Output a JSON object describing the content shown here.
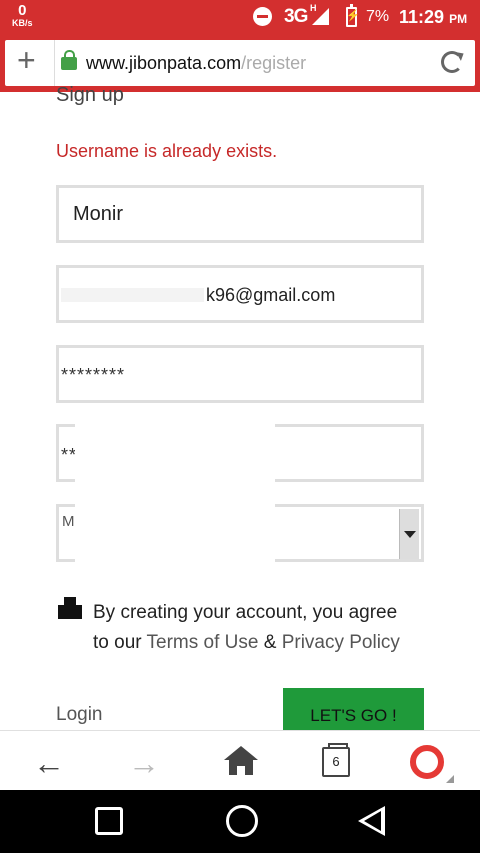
{
  "status_bar": {
    "speed_value": "0",
    "speed_unit": "KB/s",
    "network": "3G",
    "network_sub": "H",
    "battery": "7%",
    "time": "11:29",
    "ampm": "PM"
  },
  "browser": {
    "url_host": "www.jibonpata.com",
    "url_path": "/register",
    "tabs_count": "6"
  },
  "form": {
    "heading": "Sign up",
    "error": "Username is already exists.",
    "username": "Monir",
    "email": "k96@gmail.com",
    "password_mask": "********",
    "confirm_mask": "**",
    "select_value": "M",
    "consent_prefix": "By creating your account, you agree",
    "consent_to": "to our ",
    "terms": "Terms of Use",
    "amp": " & ",
    "privacy": "Privacy Policy",
    "login": "Login",
    "submit": "LET'S GO !"
  }
}
